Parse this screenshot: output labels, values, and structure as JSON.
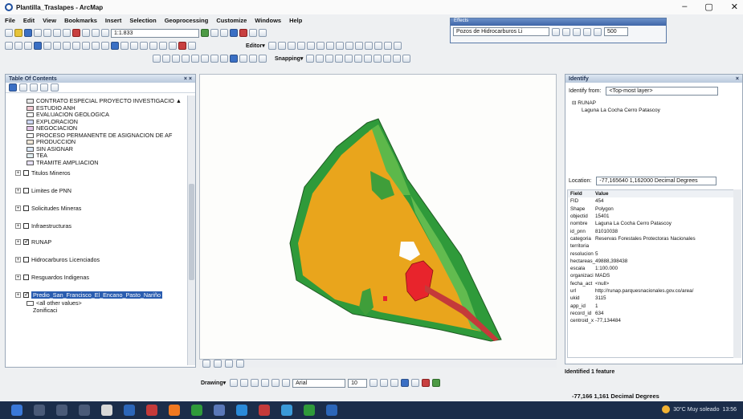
{
  "window": {
    "title": "Plantilla_Traslapes - ArcMap"
  },
  "menu": [
    "File",
    "Edit",
    "View",
    "Bookmarks",
    "Insert",
    "Selection",
    "Geoprocessing",
    "Customize",
    "Windows",
    "Help"
  ],
  "toolbar": {
    "scale_value": "1:1.833",
    "editor_label": "Editor▾",
    "snapping_label": "Snapping▾"
  },
  "effects": {
    "title": "Effects",
    "layer_select": "Pozos de Hidrocarburos Li",
    "value": "500"
  },
  "toc": {
    "title": "Table Of Contents",
    "close": "× ×",
    "rows": [
      {
        "text": "CONTRATO ESPECIAL PROYECTO INVESTIGACIO ▲",
        "kind": "sw",
        "color": "#e7e7e7"
      },
      {
        "text": "ESTUDIO ANH",
        "kind": "sw",
        "color": "#f2c9d2"
      },
      {
        "text": "EVALUACION GEOLOGICA",
        "kind": "sw",
        "color": "#ffffff"
      },
      {
        "text": "EXPLORACION",
        "kind": "sw",
        "color": "#cfd8f5"
      },
      {
        "text": "NEGOCIACION",
        "kind": "sw",
        "color": "#e4c6e9"
      },
      {
        "text": "PROCESO PERMANENTE DE ASIGNACION DE AF",
        "kind": "sw",
        "color": "#ffffff"
      },
      {
        "text": "PRODUCCION",
        "kind": "sw",
        "color": "#f0e7d8"
      },
      {
        "text": "SIN ASIGNAR",
        "kind": "sw",
        "color": "#d9e6f7"
      },
      {
        "text": "TEA",
        "kind": "sw",
        "color": "#e1eef1"
      },
      {
        "text": "TRAMITE AMPLIACION",
        "kind": "sw",
        "color": "#e7e0f4"
      },
      {
        "text": "Titulos Mineros",
        "kind": "layer",
        "checked": false
      },
      {
        "text": "Limites de PNN",
        "kind": "layer",
        "checked": false
      },
      {
        "text": "Solicitudes Mineras",
        "kind": "layer",
        "checked": false
      },
      {
        "text": "Infraestructuras",
        "kind": "layer",
        "checked": false
      },
      {
        "text": "RUNAP",
        "kind": "layer",
        "checked": true
      },
      {
        "text": "Hidrocarburos Licenciados",
        "kind": "layer",
        "checked": false
      },
      {
        "text": "Resguardos Indigenas",
        "kind": "layer",
        "checked": false
      },
      {
        "text": "Predio_San_Francisco_El_Encano_Pasto_Nariño",
        "kind": "layer",
        "checked": true,
        "selected": true
      },
      {
        "text": "<all other values>",
        "kind": "sw",
        "color": "#ffffff"
      },
      {
        "text": "Zonificaci",
        "kind": "plain"
      }
    ]
  },
  "drawing": {
    "label": "Drawing▾",
    "font": "Arial",
    "size": "10"
  },
  "identify": {
    "title": "Identify",
    "from_label": "Identify from:",
    "from_value": "<Top-most layer>",
    "tree_root": "RUNAP",
    "tree_child": "Laguna La Cocha Cerro Patascoy",
    "location_label": "Location:",
    "location_value": "-77,165640  1,162000 Decimal Degrees",
    "headers": [
      "Field",
      "Value"
    ],
    "attributes": [
      [
        "FID",
        "454"
      ],
      [
        "Shape",
        "Polygon"
      ],
      [
        "objectid",
        "15401"
      ],
      [
        "nombre",
        "Laguna La Cocha Cerro Patascoy"
      ],
      [
        "id_pnn",
        "81010038"
      ],
      [
        "categoria",
        "Reservas Forestales Protectoras Nacionales"
      ],
      [
        "territoria",
        ""
      ],
      [
        "resolucion",
        "5"
      ],
      [
        "hectareas_",
        "49888,398438"
      ],
      [
        "escala",
        "1:100.000"
      ],
      [
        "organizaci",
        "MADS"
      ],
      [
        "fecha_act",
        "<null>"
      ],
      [
        "url",
        "http://runap.parquesnacionales.gov.co/area/"
      ],
      [
        "ukid",
        "3115"
      ],
      [
        "app_id",
        "1"
      ],
      [
        "record_id",
        "634"
      ],
      [
        "centroid_x",
        "-77,134484"
      ]
    ],
    "footer": "Identified 1 feature"
  },
  "status": {
    "coordinates": "-77,166  1,161 Decimal Degrees"
  },
  "taskbar": {
    "weather": "30°C  Muy soleado",
    "time": "13:56"
  }
}
